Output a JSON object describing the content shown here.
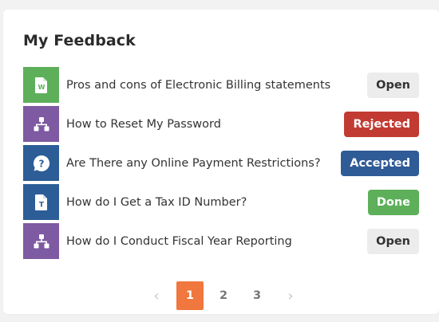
{
  "header": {
    "title": "My Feedback"
  },
  "feedback": {
    "items": [
      {
        "text": "Pros and cons of Electronic Billing statements",
        "status": "Open",
        "icon": "spreadsheet-document-icon",
        "icon_color": "#5daf5a",
        "badge_bg": "#ececec",
        "badge_fg": "#333333"
      },
      {
        "text": "How to Reset My Password",
        "status": "Rejected",
        "icon": "org-chart-icon",
        "icon_color": "#7e5aa2",
        "badge_bg": "#c23b33",
        "badge_fg": "#ffffff"
      },
      {
        "text": "Are There any Online Payment Restrictions?",
        "status": "Accepted",
        "icon": "question-bubble-icon",
        "icon_color": "#2c5d97",
        "badge_bg": "#2f5b96",
        "badge_fg": "#ffffff"
      },
      {
        "text": "How do I Get a Tax ID Number?",
        "status": "Done",
        "icon": "text-document-icon",
        "icon_color": "#2c5d97",
        "badge_bg": "#5daf5a",
        "badge_fg": "#ffffff"
      },
      {
        "text": "How do I Conduct Fiscal Year Reporting",
        "status": "Open",
        "icon": "org-chart-icon",
        "icon_color": "#7e5aa2",
        "badge_bg": "#ececec",
        "badge_fg": "#333333"
      }
    ]
  },
  "pagination": {
    "prev_icon": "chevron-left-icon",
    "next_icon": "chevron-right-icon",
    "pages": [
      "1",
      "2",
      "3"
    ],
    "active": "1",
    "active_color": "#f0773e"
  }
}
